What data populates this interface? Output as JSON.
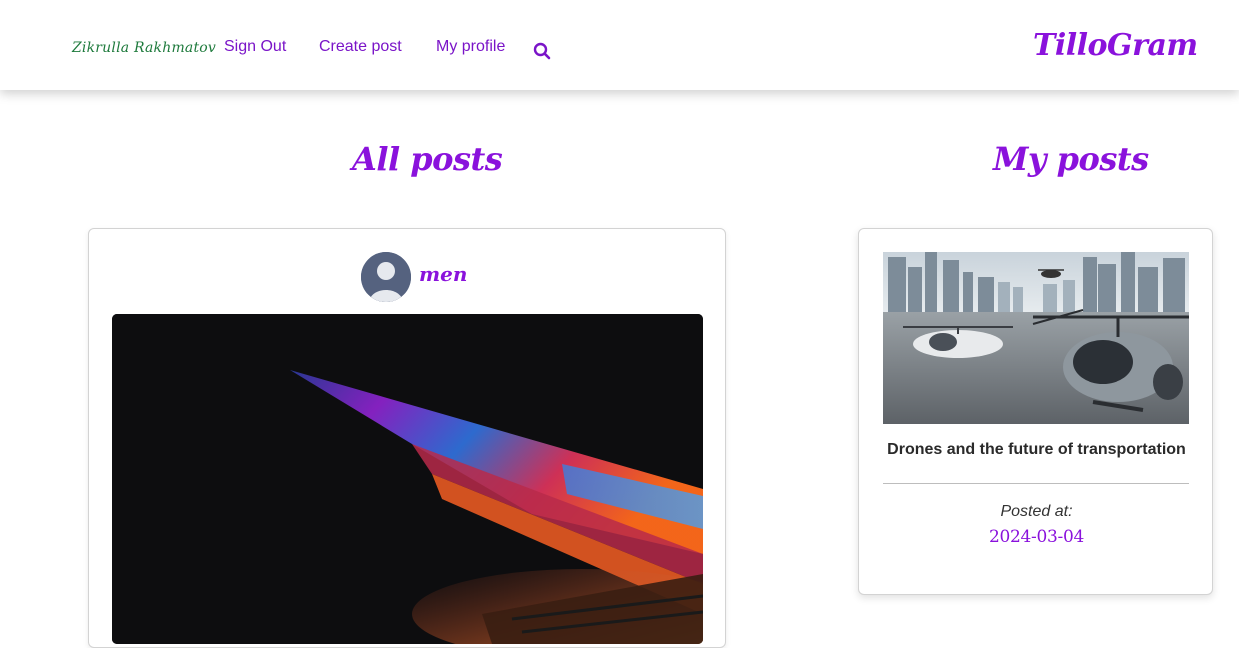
{
  "nav": {
    "user_name": "Zikrulla Rakhmatov",
    "sign_out": "Sign Out",
    "create_post": "Create post",
    "my_profile": "My profile",
    "search_icon": "search-icon",
    "brand": "TilloGram"
  },
  "all_posts": {
    "heading": "All posts",
    "posts": [
      {
        "author": "men",
        "avatar_icon": "user-avatar",
        "image": "laptop-edge-colorful"
      }
    ]
  },
  "my_posts": {
    "heading": "My posts",
    "posts": [
      {
        "image": "drones-city",
        "title": "Drones and the future of transportation",
        "posted_label": "Posted at:",
        "posted_date": "2024-03-04"
      }
    ]
  },
  "colors": {
    "accent": "#8a12dc",
    "nav_link": "#7a14c8",
    "user_name": "#1e7a3c"
  }
}
